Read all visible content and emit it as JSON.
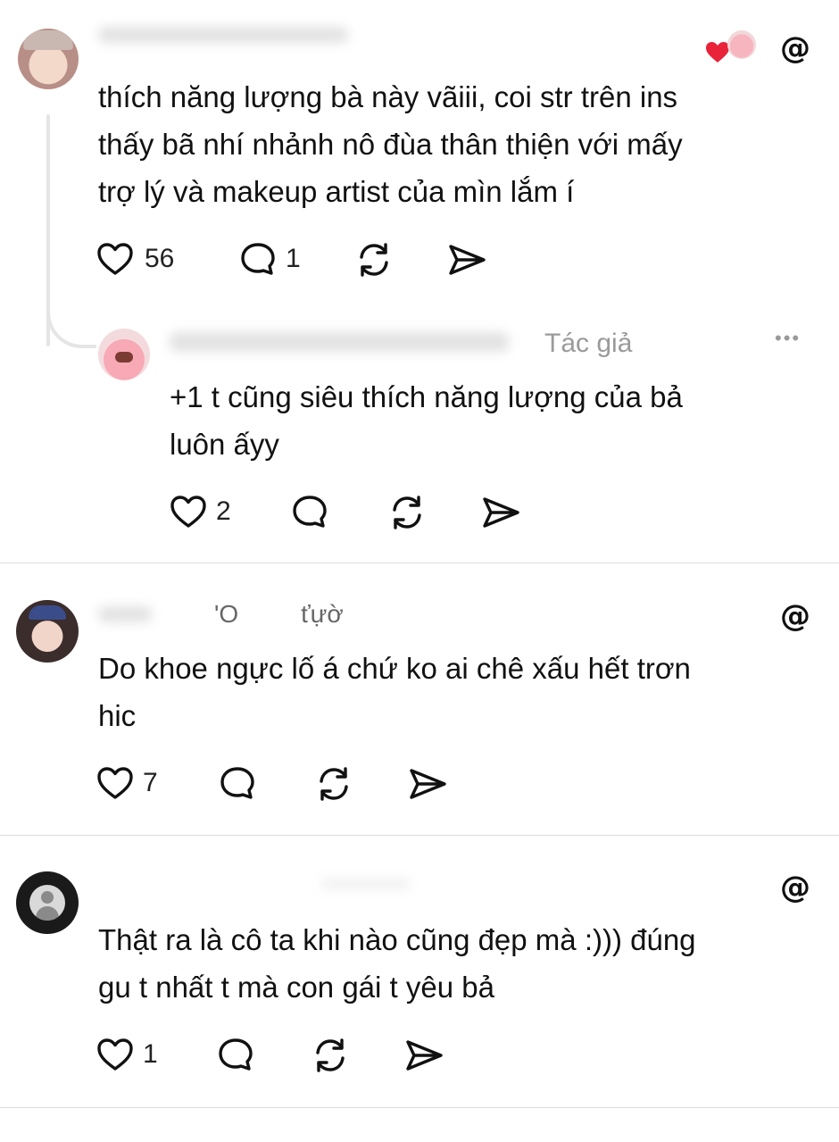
{
  "threads_icon": "threads-logo-icon",
  "post1": {
    "text_lines": [
      "thích năng lượng bà này vãiii, coi str trên ins",
      "thấy bã nhí nhảnh nô đùa thân thiện với mấy",
      "trợ lý và makeup artist của mìn lắm í"
    ],
    "likes": "56",
    "replies": "1",
    "reaction": "heart-icon"
  },
  "reply1": {
    "badge": "Tác giả",
    "more": "•••",
    "text_lines": [
      "+1 t cũng siêu thích năng lượng của bả",
      "luôn ấyy"
    ],
    "likes": "2"
  },
  "post2": {
    "username_fragment_a": "'O",
    "username_fragment_b": "ťựờ",
    "text_lines": [
      "Do khoe ngực lố á chứ ko ai chê xấu hết trơn",
      "hic"
    ],
    "likes": "7"
  },
  "post3": {
    "text_lines": [
      "Thật ra là cô ta khi nào cũng đẹp mà :))) đúng",
      "gu t nhất t mà con gái t yêu bả"
    ],
    "likes": "1"
  },
  "colors": {
    "heart": "#e8233a",
    "divider": "#dcdcdc",
    "meta": "#9a9a9a"
  }
}
